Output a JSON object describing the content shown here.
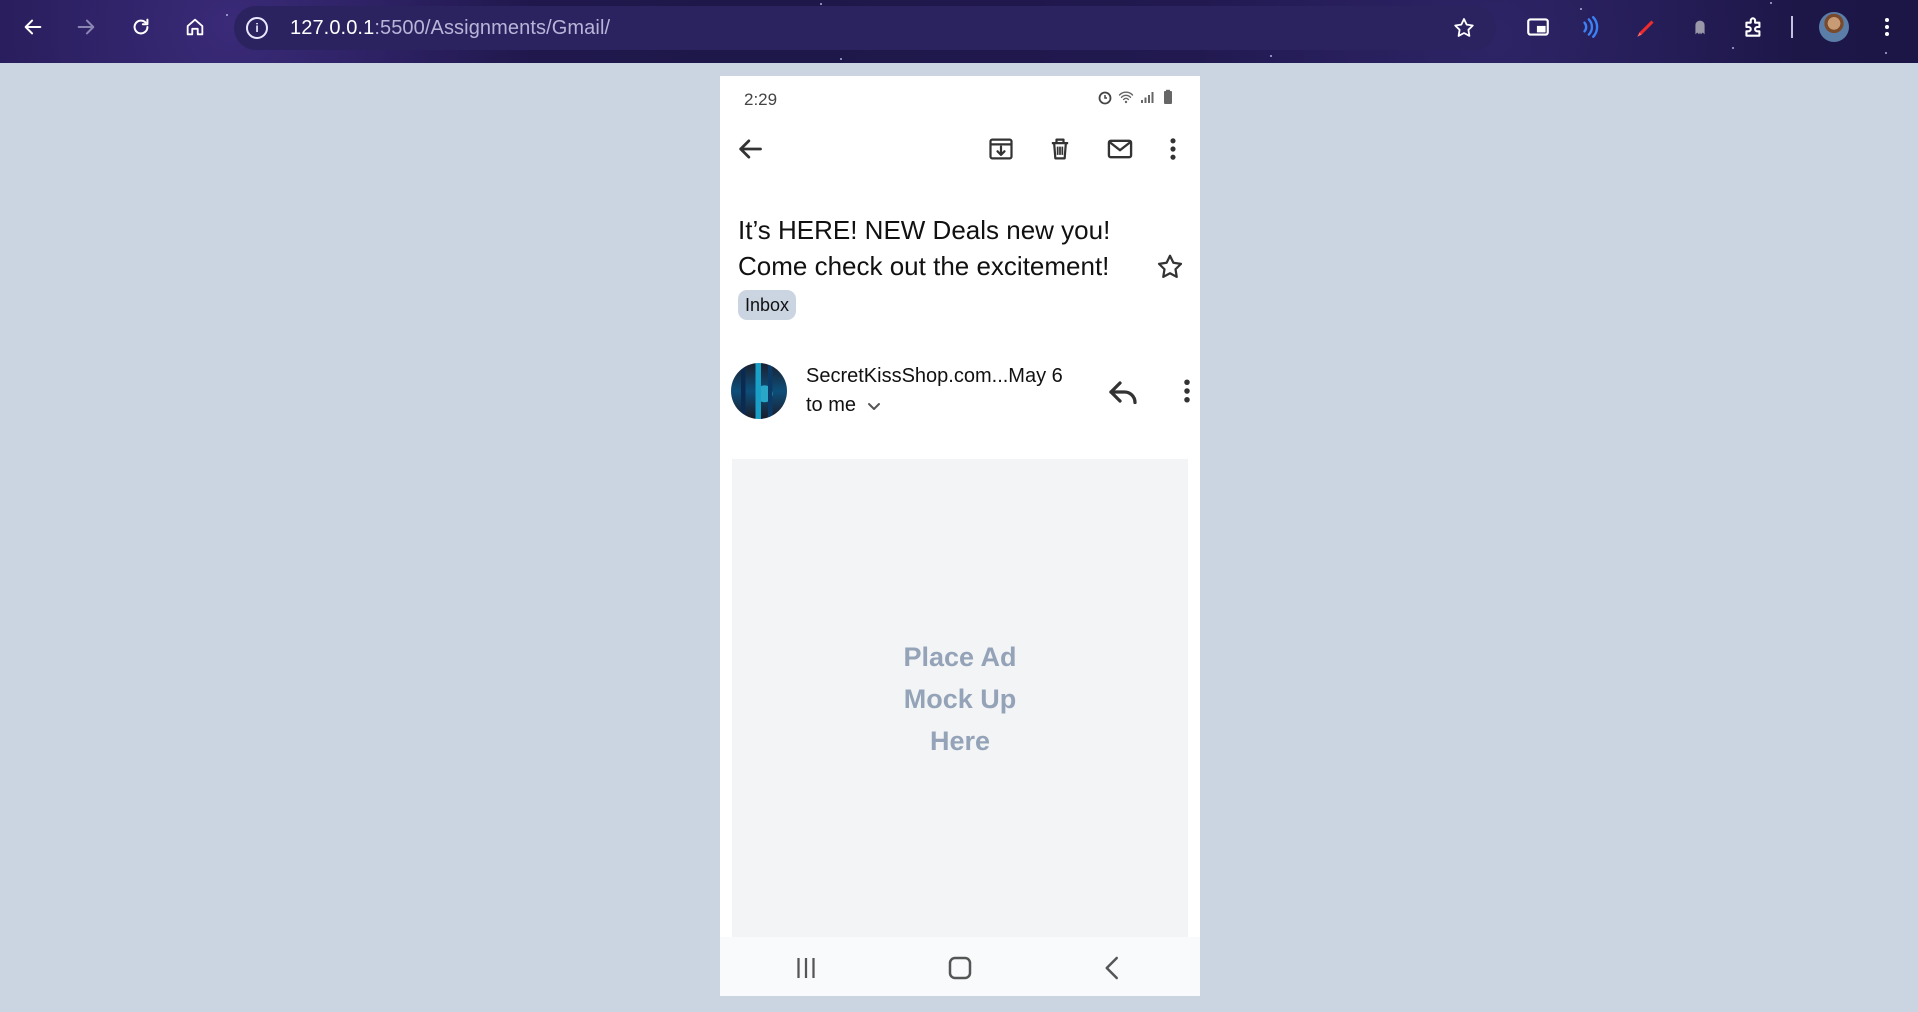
{
  "browser": {
    "url_host": "127.0.0.1",
    "url_path": ":5500/Assignments/Gmail/"
  },
  "phone": {
    "status_time": "2:29",
    "email": {
      "subject": "It’s HERE! NEW Deals new you! Come check out the excitement!",
      "label": "Inbox",
      "sender": "SecretKissShop.com...May 6",
      "recipient": "to me"
    },
    "ad": {
      "line1": "Place Ad",
      "line2": "Mock Up",
      "line3": "Here"
    }
  },
  "icons": {
    "browser": [
      "back-icon",
      "forward-icon",
      "reload-icon",
      "home-icon",
      "info-icon",
      "bookmark-star-icon",
      "picture-in-picture-icon",
      "extension-audio-icon",
      "extension-pen-icon",
      "extension-ghost-icon",
      "extensions-puzzle-icon",
      "profile-avatar",
      "chrome-menu-icon"
    ],
    "email": [
      "back-arrow-icon",
      "archive-icon",
      "delete-icon",
      "mark-unread-icon",
      "more-vert-icon",
      "star-icon",
      "reply-icon",
      "chevron-down-icon"
    ],
    "system_nav": [
      "recents-icon",
      "home-icon",
      "back-chevron-icon"
    ]
  }
}
